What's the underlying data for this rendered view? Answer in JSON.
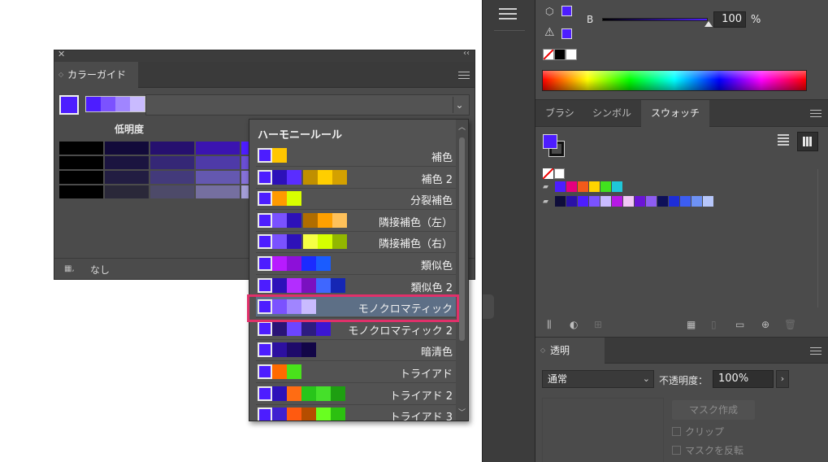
{
  "color_guide": {
    "tab_label": "カラーガイド",
    "current_color": "#4d1dff",
    "strip": [
      "#4d1dff",
      "#7b52ff",
      "#a085ff",
      "#c9bbff"
    ],
    "column_label": "低明度",
    "grid": [
      [
        "#000000",
        "#120a3a",
        "#26106f",
        "#3b14b0",
        "#4d1dff"
      ],
      [
        "#000000",
        "#1b1440",
        "#352776",
        "#4e3aa8",
        "#6a4ed3"
      ],
      [
        "#000000",
        "#221d42",
        "#433a7b",
        "#6458b0",
        "#8571d8"
      ],
      [
        "#000000",
        "#2a2839",
        "#4d4a69",
        "#756fa0",
        "#a49dd6"
      ]
    ],
    "bottom_label": "なし"
  },
  "harmony_menu": {
    "header": "ハーモニールール",
    "items": [
      {
        "label": "補色",
        "colors": [
          "#ffc600"
        ]
      },
      {
        "label": "補色 2",
        "colors": [
          "#2d11b9",
          "#5a2dff",
          "",
          "#c08f00",
          "#ffce00",
          "#d4a100"
        ]
      },
      {
        "label": "分裂補色",
        "colors": [
          "#ff9a00",
          "#d8ff00"
        ]
      },
      {
        "label": "隣接補色（左）",
        "colors": [
          "#7a52ff",
          "#2d11b9",
          "",
          "#b06d00",
          "#ffa000",
          "#ffc15a"
        ]
      },
      {
        "label": "隣接補色（右）",
        "colors": [
          "#7a52ff",
          "#2d11b9",
          "",
          "#f6ff45",
          "#d6ff00",
          "#92b700"
        ]
      },
      {
        "label": "類似色",
        "colors": [
          "#b81aff",
          "#8d10d9",
          "#1b2bff",
          "#1a5cff"
        ]
      },
      {
        "label": "類似色 2",
        "colors": [
          "#2d11b9",
          "#b32dff",
          "#7a10c0",
          "#3f67ff",
          "#1526b4"
        ]
      },
      {
        "label": "モノクロマティック",
        "colors": [
          "#7b52ff",
          "#a085ff",
          "#c9bbff"
        ]
      },
      {
        "label": "モノクロマティック 2",
        "colors": [
          "#2a1476",
          "#6c45ff",
          "#2d1c80",
          "#3b16d2"
        ]
      },
      {
        "label": "暗清色",
        "colors": [
          "#2d10a0",
          "#1e0a6a",
          "#120647"
        ]
      },
      {
        "label": "トライアド",
        "colors": [
          "#ff6a00",
          "#49e21b"
        ]
      },
      {
        "label": "トライアド 2",
        "colors": [
          "#2d11b9",
          "#ff6c13",
          "#28c51a",
          "#45e02a",
          "#1e9f11"
        ]
      },
      {
        "label": "トライアド 3",
        "colors": [
          "#3f20d0",
          "#ff5a10",
          "#b54d00",
          "#69ff20",
          "#2cc010"
        ]
      }
    ],
    "selected_index": 7
  },
  "color_panel": {
    "channel_label": "B",
    "channel_value": "100",
    "unit": "%",
    "swatch_color": "#4d1dff"
  },
  "swatches_panel": {
    "tabs": [
      "ブラシ",
      "シンボル",
      "スウォッチ"
    ],
    "active_tab": "スウォッチ",
    "row1": [
      "#4d1dff",
      "#e5007e",
      "#f35a1a",
      "#ffd400",
      "#41e11e",
      "#1fc7d8"
    ],
    "row2": [
      "#0f0d3a",
      "#2a12a6",
      "#4d1dff",
      "#7b52ff",
      "#c9bbff",
      "#b619e6",
      "#f1c7f5",
      "#6b14d6",
      "#8d5cf2",
      "#0e1058",
      "#1d2dd8",
      "#3c5df2",
      "#6e92f5",
      "#b7c7fb"
    ]
  },
  "transparency_panel": {
    "tab_label": "透明",
    "blend_mode": "通常",
    "opacity_label": "不透明度：",
    "opacity_value": "100%",
    "mask_button": "マスク作成",
    "clip_label": "クリップ",
    "invert_label": "マスクを反転"
  },
  "colors": {
    "highlight": "#e0306a",
    "selected_row": "#5d6f86",
    "panel_bg": "#4b4b4b"
  }
}
